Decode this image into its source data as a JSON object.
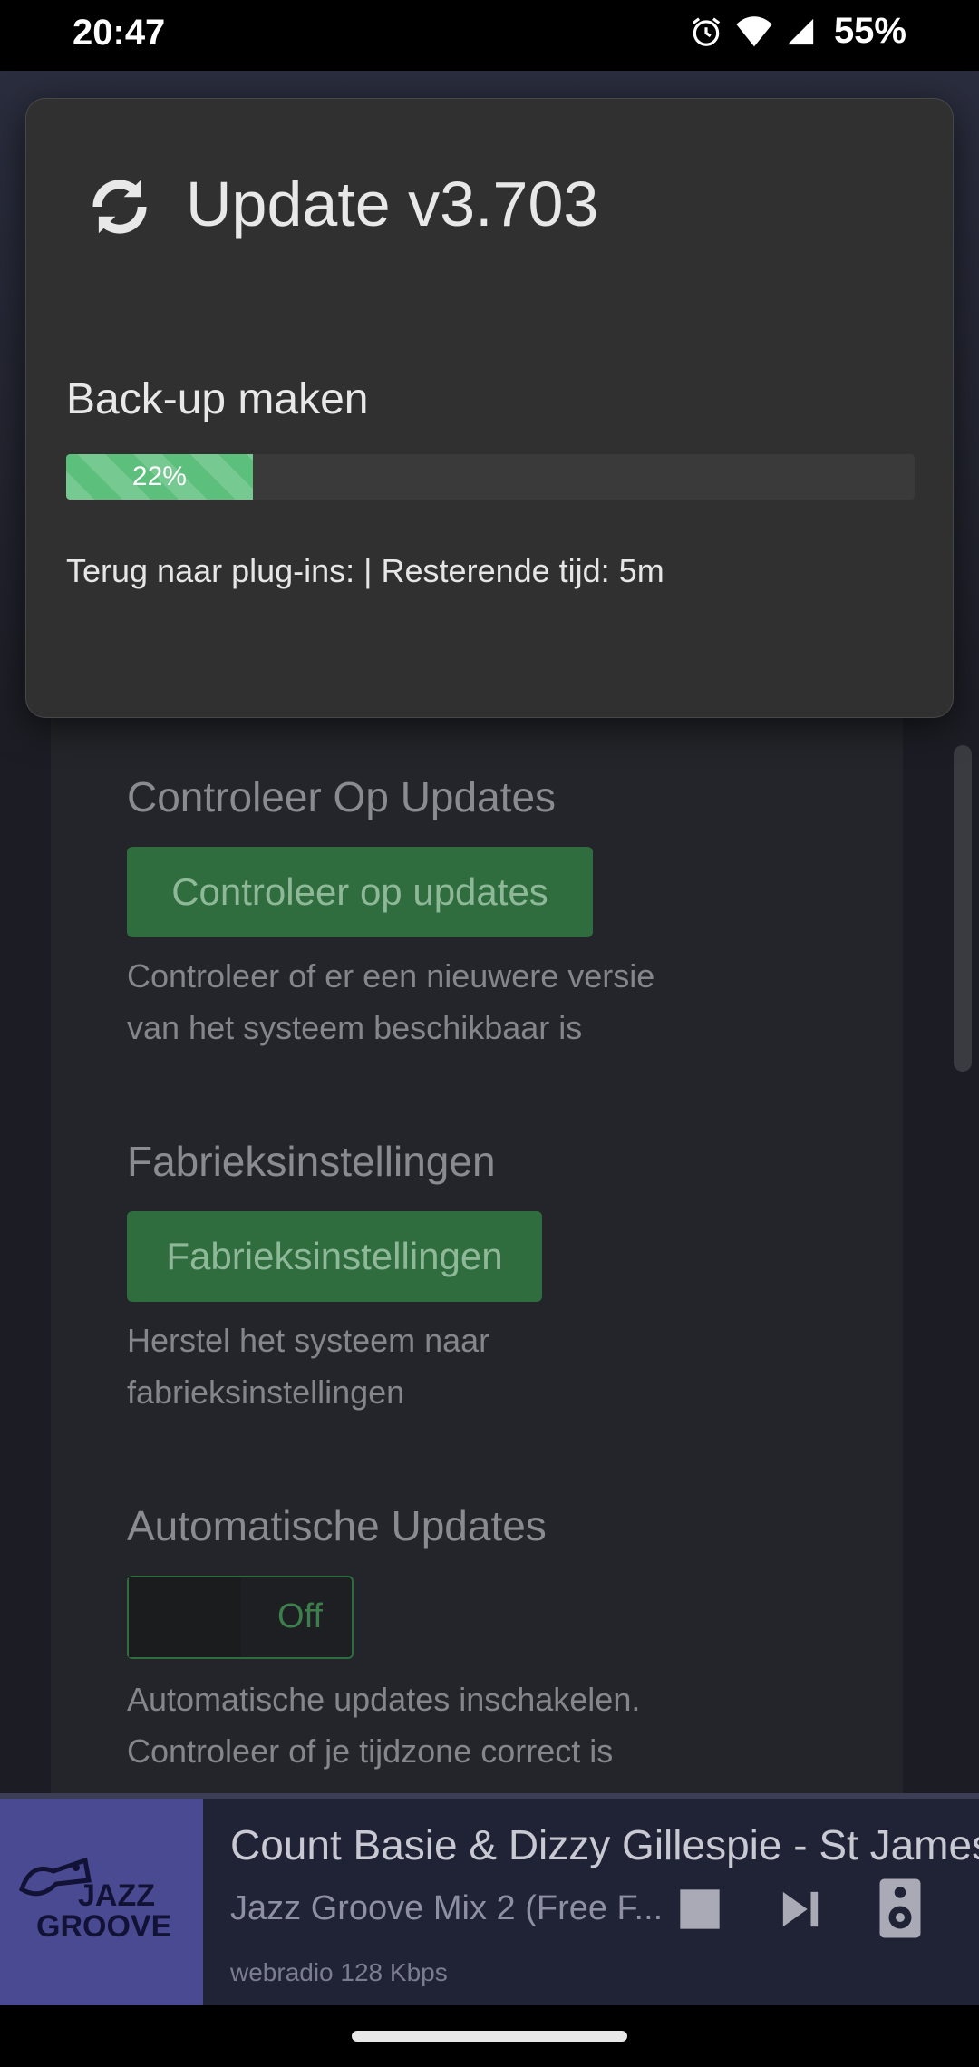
{
  "status_bar": {
    "time": "20:47",
    "battery_percent": "55%",
    "icons": [
      "alarm-icon",
      "wifi-icon",
      "signal-icon"
    ]
  },
  "modal": {
    "icon": "sync-icon",
    "title": "Update v3.703",
    "step_label": "Back-up maken",
    "progress_text": "22%",
    "progress_value": 0.22,
    "info_text": "Terug naar plug-ins: | Resterende tijd: 5m"
  },
  "settings": {
    "check_updates": {
      "title": "Controleer Op Updates",
      "button_label": "Controleer op updates",
      "description_line1": "Controleer of er een nieuwere versie",
      "description_line2": "van het systeem beschikbaar is"
    },
    "factory_reset": {
      "title": "Fabrieksinstellingen",
      "button_label": "Fabrieksinstellingen",
      "description_line1": "Herstel het systeem naar",
      "description_line2": "fabrieksinstellingen"
    },
    "auto_updates": {
      "title": "Automatische Updates",
      "toggle_label": "Off",
      "description_line1": "Automatische updates inschakelen.",
      "description_line2": "Controleer of je tijdzone correct is"
    }
  },
  "player": {
    "cover_text_line1": "JAZZ",
    "cover_text_line2": "GROOVE",
    "track_title": "Count Basie & Dizzy Gillespie - St James",
    "station": "Jazz Groove Mix 2 (Free F...",
    "bitrate": "webradio 128 Kbps",
    "controls": [
      "stop-icon",
      "next-icon",
      "speaker-icon"
    ]
  },
  "colors": {
    "accent_green": "#2f6d3f",
    "progress_green": "#5cbf7c",
    "modal_bg": "#303030"
  }
}
